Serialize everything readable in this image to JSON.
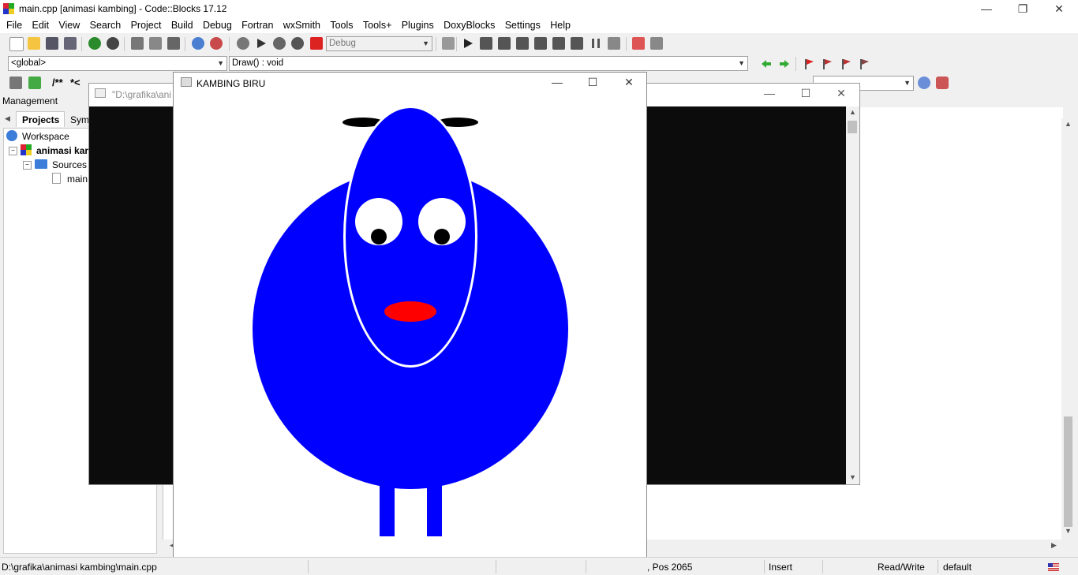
{
  "app": {
    "title": "main.cpp [animasi kambing] - Code::Blocks 17.12"
  },
  "menu": [
    "File",
    "Edit",
    "View",
    "Search",
    "Project",
    "Build",
    "Debug",
    "Fortran",
    "wxSmith",
    "Tools",
    "Tools+",
    "Plugins",
    "DoxyBlocks",
    "Settings",
    "Help"
  ],
  "toolbar": {
    "build_target": "Debug",
    "scope": "<global>",
    "function": "Draw() : void",
    "doxy_block": "/**",
    "doxy_line": "*<"
  },
  "management": {
    "title": "Management",
    "tabs": [
      "Projects",
      "Sym"
    ],
    "tree": {
      "workspace": "Workspace",
      "project": "animasi kam",
      "folder": "Sources",
      "file": "main"
    }
  },
  "console": {
    "title": "\"D:\\grafika\\ani"
  },
  "glut": {
    "title": "KAMBING BIRU",
    "colors": {
      "body": "#0000ff",
      "mouth": "#ff0000",
      "eye": "#ffffff",
      "pupil": "#000000",
      "outline": "#ffffff"
    }
  },
  "statusbar": {
    "path": "D:\\grafika\\animasi kambing\\main.cpp",
    "pos": ", Pos 2065",
    "mode": "Insert",
    "access": "Read/Write",
    "profile": "default"
  }
}
